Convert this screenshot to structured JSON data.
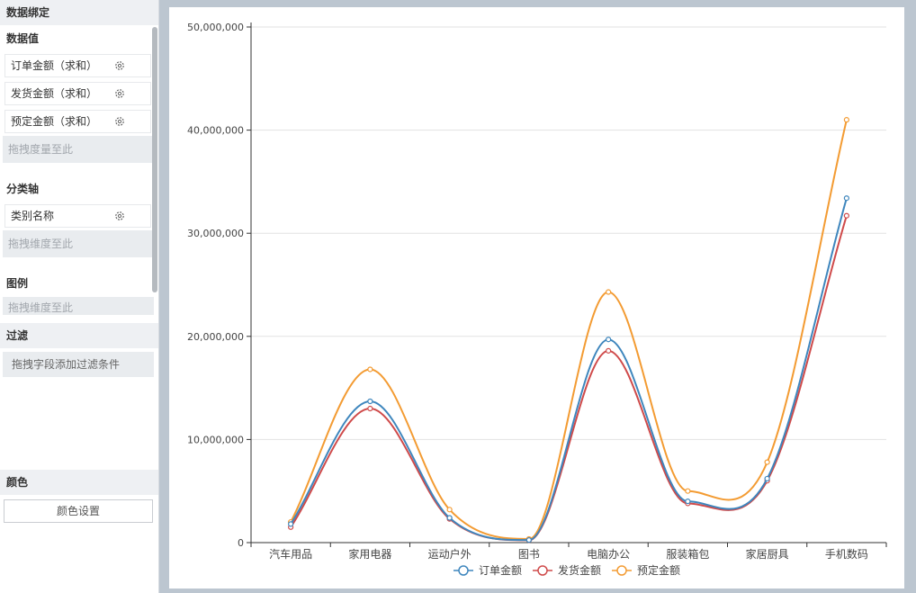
{
  "panel": {
    "header": "数据绑定",
    "values_title": "数据值",
    "measures": [
      {
        "label": "订单金额（求和）"
      },
      {
        "label": "发货金额（求和）"
      },
      {
        "label": "预定金额（求和）"
      }
    ],
    "measures_drop": "拖拽度量至此",
    "category_title": "分类轴",
    "category_field": "类别名称",
    "category_drop": "拖拽维度至此",
    "legend_title": "图例",
    "legend_drop": "拖拽维度至此",
    "filter_title": "过滤",
    "filter_drop": "拖拽字段添加过滤条件",
    "color_title": "颜色",
    "color_button": "颜色设置"
  },
  "chart_data": {
    "type": "line",
    "smooth": true,
    "categories": [
      "汽车用品",
      "家用电器",
      "运动户外",
      "图书",
      "电脑办公",
      "服装箱包",
      "家居厨具",
      "手机数码"
    ],
    "y_ticks": [
      "0",
      "10,000,000",
      "20,000,000",
      "30,000,000",
      "40,000,000",
      "50,000,000"
    ],
    "ylim": [
      0,
      50000000
    ],
    "grid": true,
    "legend_position": "bottom",
    "series": [
      {
        "name": "订单金额",
        "color": "#3e86bd",
        "values": [
          1800000,
          13700000,
          2400000,
          250000,
          19700000,
          4000000,
          6200000,
          33400000
        ]
      },
      {
        "name": "发货金额",
        "color": "#cf4a4a",
        "values": [
          1500000,
          13000000,
          2300000,
          230000,
          18600000,
          3800000,
          6000000,
          31700000
        ]
      },
      {
        "name": "预定金额",
        "color": "#f39b32",
        "values": [
          2000000,
          16800000,
          3200000,
          350000,
          24300000,
          5000000,
          7800000,
          41000000
        ]
      }
    ]
  }
}
